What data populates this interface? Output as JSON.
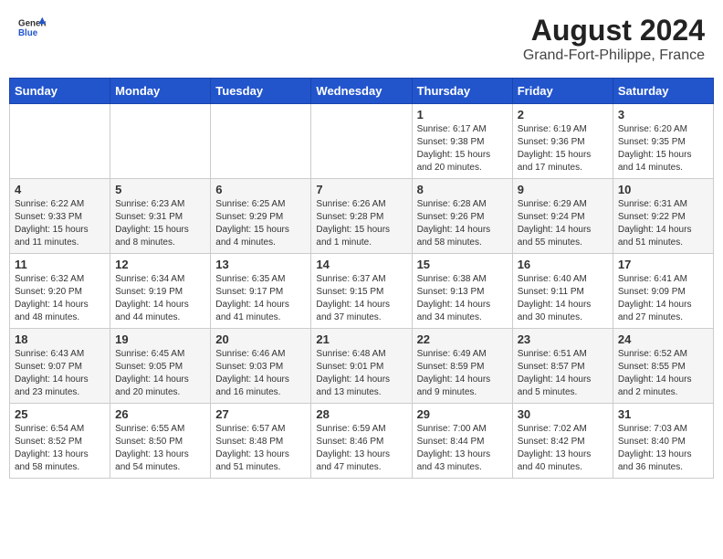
{
  "header": {
    "logo_general": "General",
    "logo_blue": "Blue",
    "month_title": "August 2024",
    "location": "Grand-Fort-Philippe, France"
  },
  "days_of_week": [
    "Sunday",
    "Monday",
    "Tuesday",
    "Wednesday",
    "Thursday",
    "Friday",
    "Saturday"
  ],
  "weeks": [
    [
      {
        "day": "",
        "info": ""
      },
      {
        "day": "",
        "info": ""
      },
      {
        "day": "",
        "info": ""
      },
      {
        "day": "",
        "info": ""
      },
      {
        "day": "1",
        "info": "Sunrise: 6:17 AM\nSunset: 9:38 PM\nDaylight: 15 hours\nand 20 minutes."
      },
      {
        "day": "2",
        "info": "Sunrise: 6:19 AM\nSunset: 9:36 PM\nDaylight: 15 hours\nand 17 minutes."
      },
      {
        "day": "3",
        "info": "Sunrise: 6:20 AM\nSunset: 9:35 PM\nDaylight: 15 hours\nand 14 minutes."
      }
    ],
    [
      {
        "day": "4",
        "info": "Sunrise: 6:22 AM\nSunset: 9:33 PM\nDaylight: 15 hours\nand 11 minutes."
      },
      {
        "day": "5",
        "info": "Sunrise: 6:23 AM\nSunset: 9:31 PM\nDaylight: 15 hours\nand 8 minutes."
      },
      {
        "day": "6",
        "info": "Sunrise: 6:25 AM\nSunset: 9:29 PM\nDaylight: 15 hours\nand 4 minutes."
      },
      {
        "day": "7",
        "info": "Sunrise: 6:26 AM\nSunset: 9:28 PM\nDaylight: 15 hours\nand 1 minute."
      },
      {
        "day": "8",
        "info": "Sunrise: 6:28 AM\nSunset: 9:26 PM\nDaylight: 14 hours\nand 58 minutes."
      },
      {
        "day": "9",
        "info": "Sunrise: 6:29 AM\nSunset: 9:24 PM\nDaylight: 14 hours\nand 55 minutes."
      },
      {
        "day": "10",
        "info": "Sunrise: 6:31 AM\nSunset: 9:22 PM\nDaylight: 14 hours\nand 51 minutes."
      }
    ],
    [
      {
        "day": "11",
        "info": "Sunrise: 6:32 AM\nSunset: 9:20 PM\nDaylight: 14 hours\nand 48 minutes."
      },
      {
        "day": "12",
        "info": "Sunrise: 6:34 AM\nSunset: 9:19 PM\nDaylight: 14 hours\nand 44 minutes."
      },
      {
        "day": "13",
        "info": "Sunrise: 6:35 AM\nSunset: 9:17 PM\nDaylight: 14 hours\nand 41 minutes."
      },
      {
        "day": "14",
        "info": "Sunrise: 6:37 AM\nSunset: 9:15 PM\nDaylight: 14 hours\nand 37 minutes."
      },
      {
        "day": "15",
        "info": "Sunrise: 6:38 AM\nSunset: 9:13 PM\nDaylight: 14 hours\nand 34 minutes."
      },
      {
        "day": "16",
        "info": "Sunrise: 6:40 AM\nSunset: 9:11 PM\nDaylight: 14 hours\nand 30 minutes."
      },
      {
        "day": "17",
        "info": "Sunrise: 6:41 AM\nSunset: 9:09 PM\nDaylight: 14 hours\nand 27 minutes."
      }
    ],
    [
      {
        "day": "18",
        "info": "Sunrise: 6:43 AM\nSunset: 9:07 PM\nDaylight: 14 hours\nand 23 minutes."
      },
      {
        "day": "19",
        "info": "Sunrise: 6:45 AM\nSunset: 9:05 PM\nDaylight: 14 hours\nand 20 minutes."
      },
      {
        "day": "20",
        "info": "Sunrise: 6:46 AM\nSunset: 9:03 PM\nDaylight: 14 hours\nand 16 minutes."
      },
      {
        "day": "21",
        "info": "Sunrise: 6:48 AM\nSunset: 9:01 PM\nDaylight: 14 hours\nand 13 minutes."
      },
      {
        "day": "22",
        "info": "Sunrise: 6:49 AM\nSunset: 8:59 PM\nDaylight: 14 hours\nand 9 minutes."
      },
      {
        "day": "23",
        "info": "Sunrise: 6:51 AM\nSunset: 8:57 PM\nDaylight: 14 hours\nand 5 minutes."
      },
      {
        "day": "24",
        "info": "Sunrise: 6:52 AM\nSunset: 8:55 PM\nDaylight: 14 hours\nand 2 minutes."
      }
    ],
    [
      {
        "day": "25",
        "info": "Sunrise: 6:54 AM\nSunset: 8:52 PM\nDaylight: 13 hours\nand 58 minutes."
      },
      {
        "day": "26",
        "info": "Sunrise: 6:55 AM\nSunset: 8:50 PM\nDaylight: 13 hours\nand 54 minutes."
      },
      {
        "day": "27",
        "info": "Sunrise: 6:57 AM\nSunset: 8:48 PM\nDaylight: 13 hours\nand 51 minutes."
      },
      {
        "day": "28",
        "info": "Sunrise: 6:59 AM\nSunset: 8:46 PM\nDaylight: 13 hours\nand 47 minutes."
      },
      {
        "day": "29",
        "info": "Sunrise: 7:00 AM\nSunset: 8:44 PM\nDaylight: 13 hours\nand 43 minutes."
      },
      {
        "day": "30",
        "info": "Sunrise: 7:02 AM\nSunset: 8:42 PM\nDaylight: 13 hours\nand 40 minutes."
      },
      {
        "day": "31",
        "info": "Sunrise: 7:03 AM\nSunset: 8:40 PM\nDaylight: 13 hours\nand 36 minutes."
      }
    ]
  ]
}
